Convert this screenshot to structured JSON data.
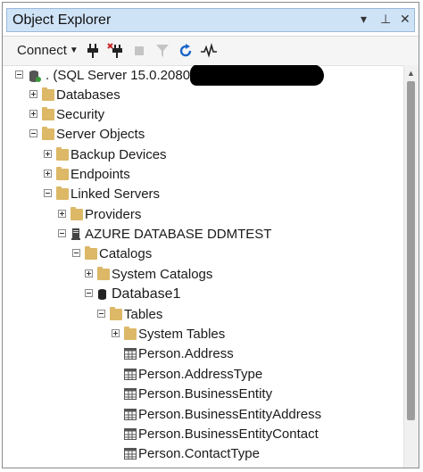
{
  "panel": {
    "title": "Object Explorer",
    "controls": {
      "dropdown": "▾",
      "pin": "⊥",
      "close": "✕"
    }
  },
  "toolbar": {
    "connect_label": "Connect",
    "icons": [
      "connect-plug-icon",
      "disconnect-plug-icon",
      "stop-icon",
      "filter-icon",
      "refresh-icon",
      "activity-monitor-icon"
    ]
  },
  "tree": {
    "server": ". (SQL Server 15.0.2080.9 -",
    "databases": "Databases",
    "security": "Security",
    "server_objects": "Server Objects",
    "backup_devices": "Backup Devices",
    "endpoints": "Endpoints",
    "linked_servers": "Linked Servers",
    "providers": "Providers",
    "azure_db": "AZURE DATABASE DDMTEST",
    "catalogs": "Catalogs",
    "system_catalogs": "System Catalogs",
    "database1": "Database1",
    "tables": "Tables",
    "system_tables": "System Tables",
    "tables_list": [
      "Person.Address",
      "Person.AddressType",
      "Person.BusinessEntity",
      "Person.BusinessEntityAddress",
      "Person.BusinessEntityContact",
      "Person.ContactType"
    ]
  },
  "colors": {
    "title_bg": "#cfe3f7",
    "folder": "#dcb867",
    "refresh": "#1a66c8"
  }
}
